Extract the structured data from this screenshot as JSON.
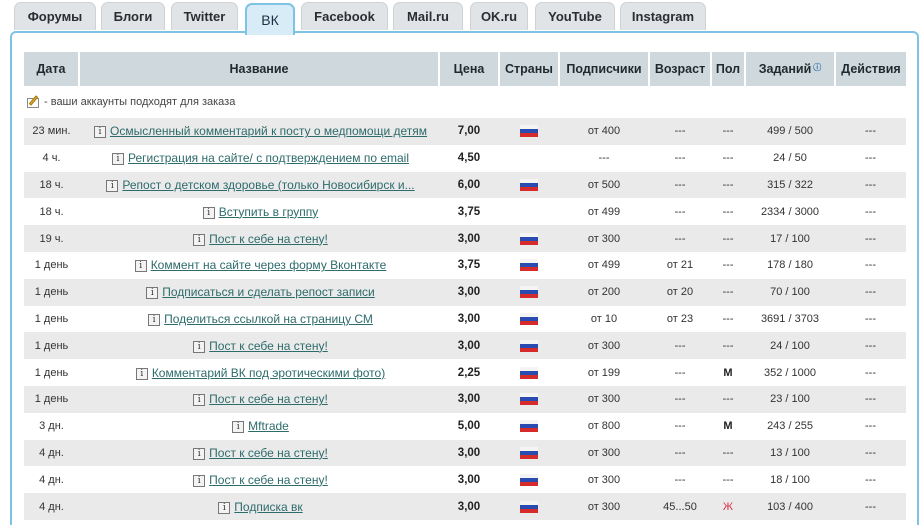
{
  "tabs": [
    {
      "label": "Форумы",
      "active": false
    },
    {
      "label": "Блоги",
      "active": false
    },
    {
      "label": "Twitter",
      "active": false
    },
    {
      "label": "ВК",
      "active": true
    },
    {
      "label": "Facebook",
      "active": false
    },
    {
      "label": "Mail.ru",
      "active": false
    },
    {
      "label": "OK.ru",
      "active": false
    },
    {
      "label": "YouTube",
      "active": false
    },
    {
      "label": "Instagram",
      "active": false
    }
  ],
  "table": {
    "headers": {
      "date": "Дата",
      "title": "Название",
      "price": "Цена",
      "countries": "Страны",
      "subscribers": "Подписчики",
      "age": "Возраст",
      "gender": "Пол",
      "tasks": "Заданий",
      "actions": "Действия"
    },
    "note": "- ваши аккаунты подходят для заказа",
    "rows": [
      {
        "date": "23 мин.",
        "title": "Осмысленный комментарий к посту о медпомощи детям",
        "price": "7,00",
        "flag": true,
        "subscribers": "от 400",
        "age": "---",
        "gender": "---",
        "tasks": "499 / 500",
        "actions": "---"
      },
      {
        "date": "4 ч.",
        "title": "Регистрация на сайте/ с подтверждением по email",
        "price": "4,50",
        "flag": false,
        "subscribers": "---",
        "age": "---",
        "gender": "---",
        "tasks": "24 / 50",
        "actions": "---"
      },
      {
        "date": "18 ч.",
        "title": "Репост о детском здоровье (только Новосибирск и...",
        "price": "6,00",
        "flag": true,
        "subscribers": "от 500",
        "age": "---",
        "gender": "---",
        "tasks": "315 / 322",
        "actions": "---"
      },
      {
        "date": "18 ч.",
        "title": "Вступить в группу",
        "price": "3,75",
        "flag": false,
        "subscribers": "от 499",
        "age": "---",
        "gender": "---",
        "tasks": "2334 / 3000",
        "actions": "---"
      },
      {
        "date": "19 ч.",
        "title": "Пост к себе на стену!",
        "price": "3,00",
        "flag": true,
        "subscribers": "от 300",
        "age": "---",
        "gender": "---",
        "tasks": "17 / 100",
        "actions": "---"
      },
      {
        "date": "1 день",
        "title": "Коммент на сайте через форму Вконтакте",
        "price": "3,75",
        "flag": true,
        "subscribers": "от 499",
        "age": "от 21",
        "gender": "---",
        "tasks": "178 / 180",
        "actions": "---"
      },
      {
        "date": "1 день",
        "title": "Подписаться и сделать репост записи",
        "price": "3,00",
        "flag": true,
        "subscribers": "от 200",
        "age": "от 20",
        "gender": "---",
        "tasks": "70 / 100",
        "actions": "---"
      },
      {
        "date": "1 день",
        "title": "Поделиться ссылкой на страницу СМ",
        "price": "3,00",
        "flag": true,
        "subscribers": "от 10",
        "age": "от 23",
        "gender": "---",
        "tasks": "3691 / 3703",
        "actions": "---"
      },
      {
        "date": "1 день",
        "title": "Пост к себе на стену!",
        "price": "3,00",
        "flag": true,
        "subscribers": "от 300",
        "age": "---",
        "gender": "---",
        "tasks": "24 / 100",
        "actions": "---"
      },
      {
        "date": "1 день",
        "title": "Комментарий ВК под эротическими фото)",
        "price": "2,25",
        "flag": true,
        "subscribers": "от 199",
        "age": "---",
        "gender": "М",
        "tasks": "352 / 1000",
        "actions": "---"
      },
      {
        "date": "1 день",
        "title": "Пост к себе на стену!",
        "price": "3,00",
        "flag": true,
        "subscribers": "от 300",
        "age": "---",
        "gender": "---",
        "tasks": "23 / 100",
        "actions": "---"
      },
      {
        "date": "3 дн.",
        "title": "Mftrade",
        "price": "5,00",
        "flag": true,
        "subscribers": "от 800",
        "age": "---",
        "gender": "М",
        "tasks": "243 / 255",
        "actions": "---"
      },
      {
        "date": "4 дн.",
        "title": "Пост к себе на стену!",
        "price": "3,00",
        "flag": true,
        "subscribers": "от 300",
        "age": "---",
        "gender": "---",
        "tasks": "13 / 100",
        "actions": "---"
      },
      {
        "date": "4 дн.",
        "title": "Пост к себе на стену!",
        "price": "3,00",
        "flag": true,
        "subscribers": "от 300",
        "age": "---",
        "gender": "---",
        "tasks": "18 / 100",
        "actions": "---"
      },
      {
        "date": "4 дн.",
        "title": "Подписка вк",
        "price": "3,00",
        "flag": true,
        "subscribers": "от 300",
        "age": "45...50",
        "gender": "Ж",
        "tasks": "103 / 400",
        "actions": "---"
      }
    ]
  }
}
